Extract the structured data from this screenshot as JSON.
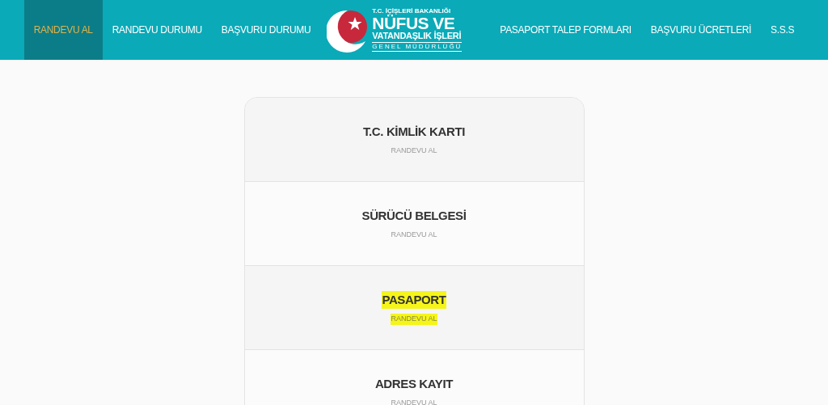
{
  "nav_left": [
    {
      "label": "RANDEVU AL",
      "selected": true
    },
    {
      "label": "RANDEVU DURUMU",
      "selected": false
    },
    {
      "label": "BAŞVURU DURUMU",
      "selected": false
    }
  ],
  "logo": {
    "ministry": "T.C. İÇİŞLERİ BAKANLIĞI",
    "line_1": "NÜFUS VE",
    "line_2": "VATANDAŞLIK İŞLERİ",
    "line_3": "GENEL MÜDÜRLÜĞÜ"
  },
  "nav_right": [
    {
      "label": "PASAPORT TALEP FORMLARI",
      "selected": false
    },
    {
      "label": "BAŞVURU ÜCRETLERİ",
      "selected": false
    },
    {
      "label": "S.S.S",
      "selected": false
    }
  ],
  "services": [
    {
      "title": "T.C. KİMLİK KARTI",
      "action": "RANDEVU AL",
      "highlighted": false
    },
    {
      "title": "SÜRÜCÜ BELGESİ",
      "action": "RANDEVU AL",
      "highlighted": false
    },
    {
      "title": "PASAPORT",
      "action": "RANDEVU AL",
      "highlighted": true
    },
    {
      "title": "ADRES KAYIT",
      "action": "RANDEVU AL",
      "highlighted": false
    }
  ]
}
